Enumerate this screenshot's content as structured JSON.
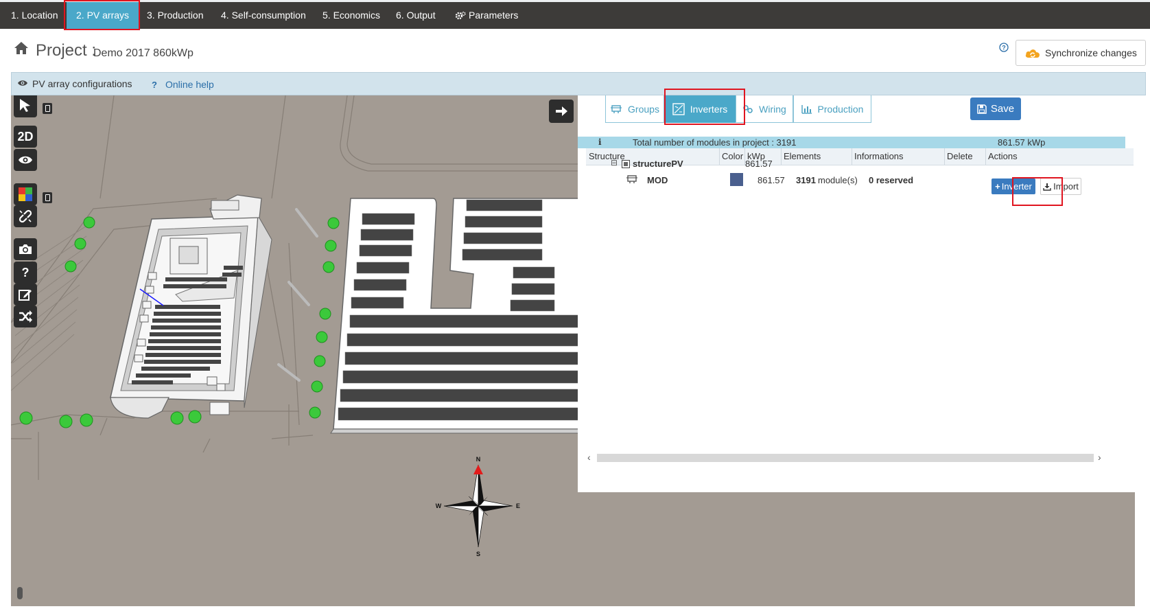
{
  "nav": {
    "items": [
      {
        "label": "1. Location"
      },
      {
        "label": "2. PV arrays"
      },
      {
        "label": "3. Production"
      },
      {
        "label": "4. Self-consumption"
      },
      {
        "label": "5. Economics"
      },
      {
        "label": "6. Output"
      },
      {
        "label": "Parameters"
      }
    ],
    "active_index": 1
  },
  "project": {
    "label": "Project :",
    "name": "Demo 2017 860kWp",
    "sync_label": "Synchronize changes"
  },
  "panel": {
    "title": "PV array configurations",
    "help_label": "Online help"
  },
  "toolbar": {
    "mode_2d": "2D"
  },
  "compass": {
    "n": "N",
    "s": "S",
    "e": "E",
    "w": "W"
  },
  "side": {
    "tabs": [
      {
        "label": "Groups",
        "icon": "groups-icon"
      },
      {
        "label": "Inverters",
        "icon": "inverter-icon"
      },
      {
        "label": "Wiring",
        "icon": "link-icon"
      },
      {
        "label": "Production",
        "icon": "bar-chart-icon"
      }
    ],
    "active_tab": 1,
    "save_label": "Save",
    "total_text": "Total number of modules in project : 3191",
    "total_kwp": "861.57 kWp",
    "columns": [
      "Structure",
      "Color",
      "kWp",
      "Elements",
      "Informations",
      "Delete",
      "Actions"
    ],
    "rows": [
      {
        "structure": "structurePV",
        "kwp": "861.57"
      },
      {
        "structure": "MOD",
        "color": "#4a5f8e",
        "kwp": "861.57",
        "elements_count": "3191",
        "elements_unit": "module(s)",
        "info": "0 reserved",
        "add_label": "Inverter",
        "import_label": "Import"
      }
    ]
  },
  "colors": {
    "nav_bg": "#3d3b39",
    "nav_active": "#4aa8c9",
    "highlight": "#e0141f",
    "save_blue": "#3a7bbf",
    "ground": "#a39b93"
  }
}
